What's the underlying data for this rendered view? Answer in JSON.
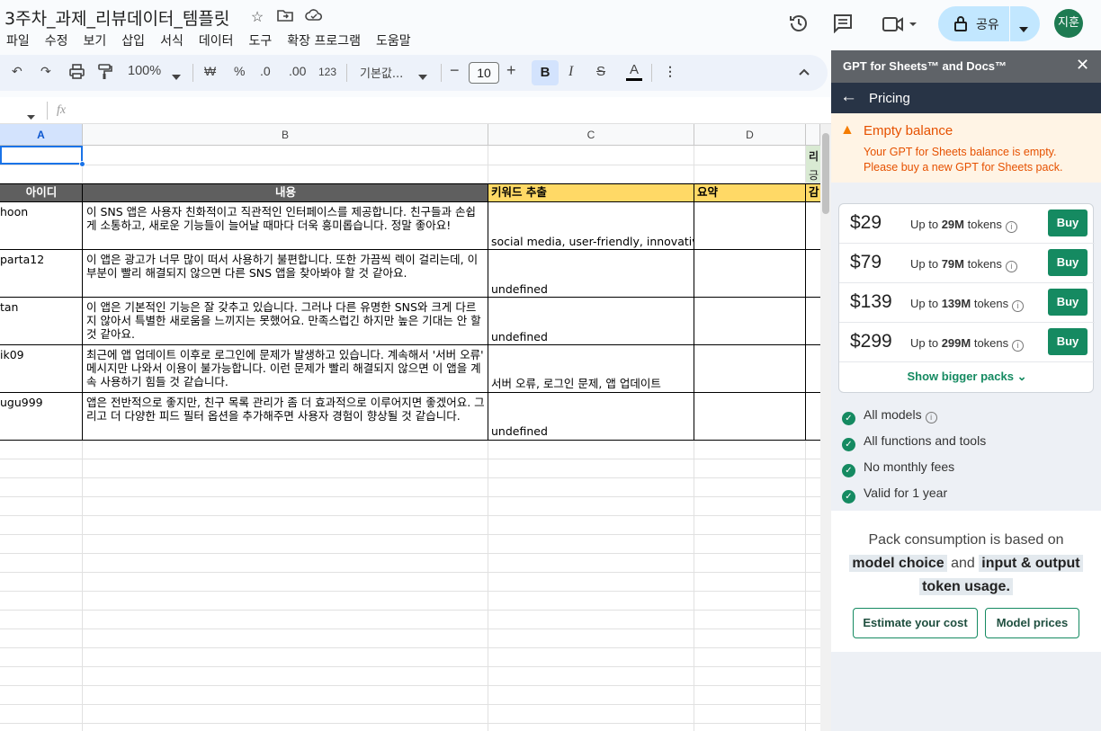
{
  "doc": {
    "title": "3주차_과제_리뷰데이터_템플릿",
    "menus": [
      "파일",
      "수정",
      "보기",
      "삽입",
      "서식",
      "데이터",
      "도구",
      "확장 프로그램",
      "도움말"
    ]
  },
  "header": {
    "share_label": "공유",
    "avatar_label": "지훈"
  },
  "toolbar": {
    "zoom": "100%",
    "currency": "₩",
    "percent": "%",
    "dec_dec": ".0",
    "dec_inc": ".00",
    "number_format": "123",
    "font": "기본값...",
    "font_size": "10",
    "bold": "B",
    "italic": "I",
    "strike": "S",
    "text_color": "A",
    "more": "⋮"
  },
  "formula": {
    "fx": "fx"
  },
  "sheet": {
    "columns": [
      "A",
      "B",
      "C",
      "D"
    ],
    "headers": [
      "아이디",
      "내용",
      "키워드 추출",
      "요약"
    ],
    "side_fragments": [
      "리",
      "긍",
      "감"
    ],
    "rows": [
      {
        "id": "hoon",
        "content": "이 SNS 앱은 사용자 친화적이고 직관적인 인터페이스를 제공합니다. 친구들과 손쉽게 소통하고, 새로운 기능들이 늘어날 때마다 더욱 흥미롭습니다. 정말 좋아요!",
        "keywords": "social media, user-friendly, innovative",
        "summary": ""
      },
      {
        "id": "parta12",
        "content": "이 앱은 광고가 너무 많이 떠서 사용하기 불편합니다. 또한 가끔씩 렉이 걸리는데, 이 부분이 빨리 해결되지 않으면 다른 SNS 앱을 찾아봐야 할 것 같아요.",
        "keywords": "undefined",
        "summary": ""
      },
      {
        "id": "tan",
        "content": "이 앱은 기본적인 기능은 잘 갖추고 있습니다. 그러나 다른 유명한 SNS와 크게 다르지 않아서 특별한 새로움을 느끼지는 못했어요. 만족스럽긴 하지만 높은 기대는 안 할 것 같아요.",
        "keywords": "undefined",
        "summary": ""
      },
      {
        "id": "ik09",
        "content": "최근에 앱 업데이트 이후로 로그인에 문제가 발생하고 있습니다. 계속해서 '서버 오류' 메시지만 나와서 이용이 불가능합니다. 이런 문제가 빨리 해결되지 않으면 이 앱을 계속 사용하기 힘들 것 같습니다.",
        "keywords": "서버 오류, 로그인 문제, 앱 업데이트",
        "summary": ""
      },
      {
        "id": "ugu999",
        "content": "앱은 전반적으로 좋지만, 친구 목록 관리가 좀 더 효과적으로 이루어지면 좋겠어요. 그리고 더 다양한 피드 필터 옵션을 추가해주면 사용자 경험이 향상될 것 같습니다.",
        "keywords": "undefined",
        "summary": ""
      }
    ]
  },
  "panel": {
    "title": "GPT for Sheets™ and Docs™",
    "nav_title": "Pricing",
    "warning_title": "Empty balance",
    "warning_body_1": "Your GPT for Sheets balance is empty.",
    "warning_body_2": "Please buy a new GPT for Sheets pack.",
    "packs": [
      {
        "price": "$29",
        "pre": "Up to ",
        "tokens": "29M",
        "post": " tokens",
        "buy": "Buy"
      },
      {
        "price": "$79",
        "pre": "Up to ",
        "tokens": "79M",
        "post": " tokens",
        "buy": "Buy"
      },
      {
        "price": "$139",
        "pre": "Up to ",
        "tokens": "139M",
        "post": " tokens",
        "buy": "Buy"
      },
      {
        "price": "$299",
        "pre": "Up to ",
        "tokens": "299M",
        "post": " tokens",
        "buy": "Buy"
      }
    ],
    "show_bigger": "Show bigger packs",
    "features": [
      "All models",
      "All functions and tools",
      "No monthly fees",
      "Valid for 1 year"
    ],
    "consumption": {
      "line1": "Pack consumption is based on",
      "hl1": "model choice",
      "and": "and",
      "hl2": "input & output",
      "hl3": "token usage."
    },
    "estimate_label": "Estimate your cost",
    "model_prices_label": "Model prices",
    "colors": {
      "accent": "#158a61",
      "warn": "#e65100",
      "nav": "#283446"
    }
  }
}
